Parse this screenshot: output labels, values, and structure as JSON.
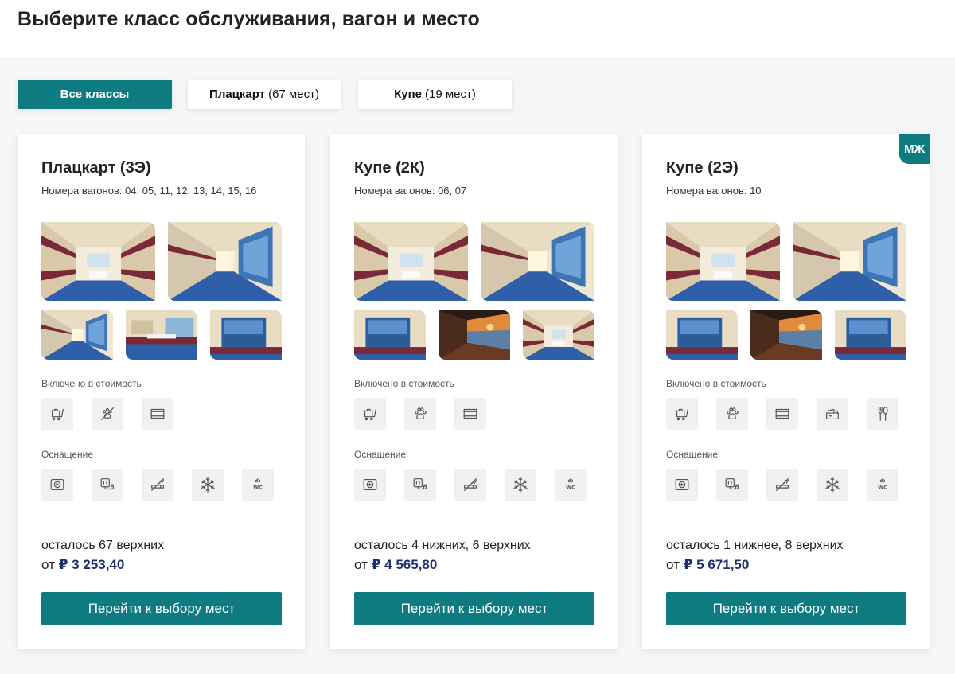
{
  "page": {
    "title": "Выберите класс обслуживания, вагон и место"
  },
  "filters": [
    {
      "label": "Все классы",
      "count": "",
      "active": true
    },
    {
      "label": "Плацкарт",
      "count": "(67 мест)",
      "active": false
    },
    {
      "label": "Купе",
      "count": "(19 мест)",
      "active": false
    }
  ],
  "cards": [
    {
      "title": "Плацкарт (3Э)",
      "cars": "Номера вагонов: 04, 05, 11, 12, 13, 14, 15, 16",
      "badge": "",
      "included_label": "Включено в стоимость",
      "included_icons": [
        "luggage-cart-icon",
        "no-pets-icon",
        "window-tv-icon"
      ],
      "equipment_label": "Оснащение",
      "equipment_icons": [
        "media-player-icon",
        "power-socket-icon",
        "no-smoking-icon",
        "air-conditioning-icon",
        "wc-icon"
      ],
      "remaining": "осталось 67 верхних",
      "price_prefix": "от",
      "price": "₽ 3 253,40",
      "button": "Перейти к выбору мест"
    },
    {
      "title": "Купе (2К)",
      "cars": "Номера вагонов: 06, 07",
      "badge": "",
      "included_label": "Включено в стоимость",
      "included_icons": [
        "luggage-cart-icon",
        "pet-paw-icon",
        "window-tv-icon"
      ],
      "equipment_label": "Оснащение",
      "equipment_icons": [
        "media-player-icon",
        "power-socket-icon",
        "no-smoking-icon",
        "air-conditioning-icon",
        "wc-icon"
      ],
      "remaining": "осталось 4 нижних, 6 верхних",
      "price_prefix": "от",
      "price": "₽ 4 565,80",
      "button": "Перейти к выбору мест"
    },
    {
      "title": "Купе (2Э)",
      "cars": "Номера вагонов: 10",
      "badge": "МЖ",
      "included_label": "Включено в стоимость",
      "included_icons": [
        "luggage-cart-icon",
        "pet-paw-icon",
        "window-tv-icon",
        "hygiene-kit-icon",
        "meal-icon"
      ],
      "equipment_label": "Оснащение",
      "equipment_icons": [
        "media-player-icon",
        "power-socket-icon",
        "no-smoking-icon",
        "air-conditioning-icon",
        "wc-icon"
      ],
      "remaining": "осталось 1 нижнее, 8 верхних",
      "price_prefix": "от",
      "price": "₽ 5 671,50",
      "button": "Перейти к выбору мест"
    }
  ],
  "colors": {
    "accent": "#0e7b81",
    "price": "#1f2f6e",
    "background": "#f6f6f6"
  }
}
